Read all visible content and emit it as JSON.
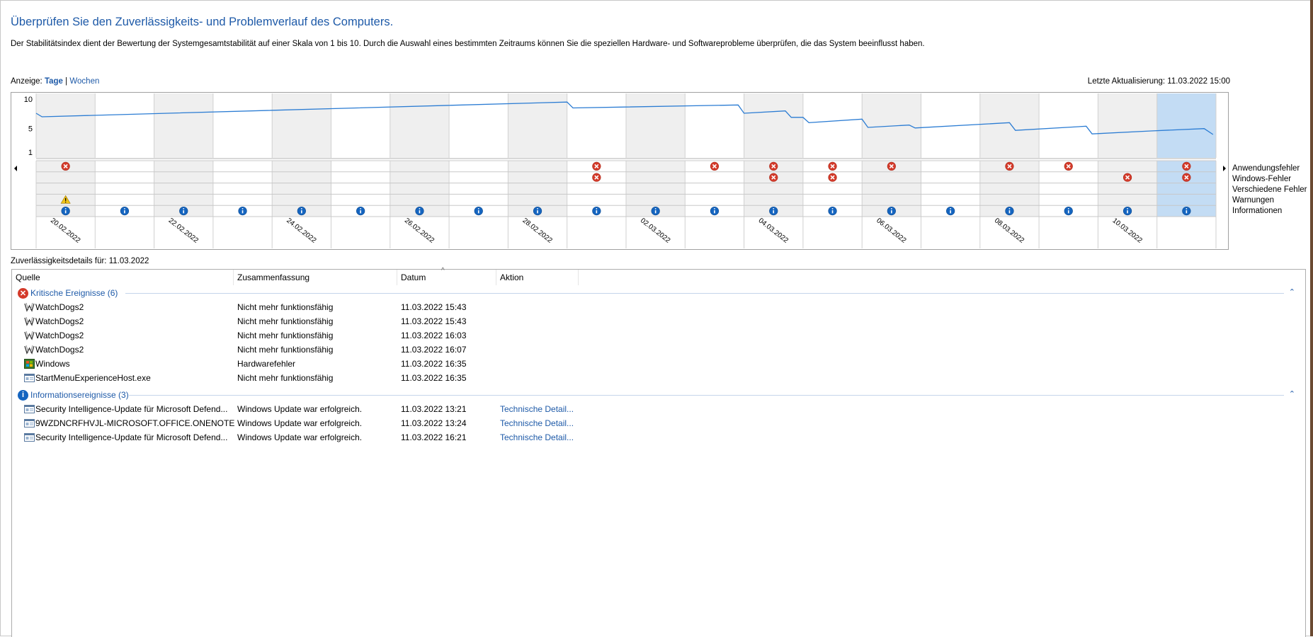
{
  "header": {
    "title": "Überprüfen Sie den Zuverlässigkeits- und Problemverlauf des Computers.",
    "description": "Der Stabilitätsindex dient der Bewertung der Systemgesamtstabilität auf einer Skala von 1 bis 10. Durch die Auswahl eines bestimmten Zeitraums können Sie die speziellen Hardware- und Softwareprobleme überprüfen, die das System beeinflusst haben."
  },
  "view": {
    "label": "Anzeige:",
    "days": "Tage",
    "separator": "|",
    "weeks": "Wochen",
    "last_update": "Letzte Aktualisierung: 11.03.2022 15:00"
  },
  "legend": [
    "Anwendungsfehler",
    "Windows-Fehler",
    "Verschiedene Fehler",
    "Warnungen",
    "Informationen"
  ],
  "colors": {
    "accent": "#1e5aa8",
    "line": "#2b7cd3",
    "error": "#d43a2a",
    "warning": "#f0c419",
    "info": "#1565c0",
    "selected": "#c3dcf4",
    "shade": "#efefef"
  },
  "chart_data": {
    "type": "line",
    "title": "",
    "ylim": [
      1,
      10
    ],
    "y_ticks": [
      "10",
      "5",
      "1"
    ],
    "columns": 20,
    "x_tick_labels": [
      "20.02.2022",
      "22.02.2022",
      "24.02.2022",
      "26.02.2022",
      "28.02.2022",
      "02.03.2022",
      "04.03.2022",
      "06.03.2022",
      "08.03.2022",
      "10.03.2022"
    ],
    "x_tick_columns": [
      0,
      2,
      4,
      6,
      8,
      10,
      12,
      14,
      16,
      18
    ],
    "stability_series": [
      {
        "x": 0.0,
        "y": 7.6
      },
      {
        "x": 0.1,
        "y": 7.0
      },
      {
        "x": 9.0,
        "y": 9.5
      },
      {
        "x": 9.1,
        "y": 8.5
      },
      {
        "x": 11.9,
        "y": 9.0
      },
      {
        "x": 12.0,
        "y": 7.6
      },
      {
        "x": 12.7,
        "y": 8.0
      },
      {
        "x": 12.8,
        "y": 6.9
      },
      {
        "x": 13.0,
        "y": 6.9
      },
      {
        "x": 13.1,
        "y": 6.0
      },
      {
        "x": 14.0,
        "y": 6.6
      },
      {
        "x": 14.1,
        "y": 5.2
      },
      {
        "x": 14.8,
        "y": 5.6
      },
      {
        "x": 14.9,
        "y": 5.1
      },
      {
        "x": 16.5,
        "y": 6.0
      },
      {
        "x": 16.6,
        "y": 4.7
      },
      {
        "x": 17.8,
        "y": 5.4
      },
      {
        "x": 17.9,
        "y": 4.1
      },
      {
        "x": 18.9,
        "y": 4.6
      },
      {
        "x": 19.8,
        "y": 5.0
      },
      {
        "x": 19.95,
        "y": 4.0
      }
    ],
    "selected_column": 19,
    "shaded_columns": [
      0,
      2,
      4,
      6,
      8,
      10,
      12,
      14,
      16,
      18
    ],
    "event_rows": [
      {
        "name": "Anwendungsfehler",
        "kind": "error",
        "columns": [
          0,
          9,
          11,
          12,
          13,
          14,
          16,
          17,
          19
        ]
      },
      {
        "name": "Windows-Fehler",
        "kind": "error",
        "columns": [
          9,
          12,
          13,
          18,
          19
        ]
      },
      {
        "name": "Verschiedene Fehler",
        "kind": "error",
        "columns": []
      },
      {
        "name": "Warnungen",
        "kind": "warning",
        "columns": [
          0
        ]
      },
      {
        "name": "Informationen",
        "kind": "info",
        "columns": [
          0,
          1,
          2,
          3,
          4,
          5,
          6,
          7,
          8,
          9,
          10,
          11,
          12,
          13,
          14,
          15,
          16,
          17,
          18,
          19
        ]
      }
    ]
  },
  "details": {
    "label": "Zuverlässigkeitsdetails für: 11.03.2022"
  },
  "table": {
    "columns": [
      "Quelle",
      "Zusammenfassung",
      "Datum",
      "Aktion"
    ],
    "sort_indicator": "^",
    "groups": [
      {
        "title": "Kritische Ereignisse (6)",
        "kind": "error",
        "rows": [
          {
            "icon": "watchdogs-icon",
            "source": "WatchDogs2",
            "summary": "Nicht mehr funktionsfähig",
            "date": "11.03.2022 15:43",
            "action": ""
          },
          {
            "icon": "watchdogs-icon",
            "source": "WatchDogs2",
            "summary": "Nicht mehr funktionsfähig",
            "date": "11.03.2022 15:43",
            "action": ""
          },
          {
            "icon": "watchdogs-icon",
            "source": "WatchDogs2",
            "summary": "Nicht mehr funktionsfähig",
            "date": "11.03.2022 16:03",
            "action": ""
          },
          {
            "icon": "watchdogs-icon",
            "source": "WatchDogs2",
            "summary": "Nicht mehr funktionsfähig",
            "date": "11.03.2022 16:07",
            "action": ""
          },
          {
            "icon": "windows-icon",
            "source": "Windows",
            "summary": "Hardwarefehler",
            "date": "11.03.2022 16:35",
            "action": ""
          },
          {
            "icon": "app-window-icon",
            "source": "StartMenuExperienceHost.exe",
            "summary": "Nicht mehr funktionsfähig",
            "date": "11.03.2022 16:35",
            "action": ""
          }
        ]
      },
      {
        "title": "Informationsereignisse (3)",
        "kind": "info",
        "rows": [
          {
            "icon": "app-window-icon",
            "source": "Security Intelligence-Update für Microsoft Defend...",
            "summary": "Windows Update war erfolgreich.",
            "date": "11.03.2022 13:21",
            "action": "Technische Detail..."
          },
          {
            "icon": "app-window-icon",
            "source": "9WZDNCRFHVJL-MICROSOFT.OFFICE.ONENOTE",
            "summary": "Windows Update war erfolgreich.",
            "date": "11.03.2022 13:24",
            "action": "Technische Detail..."
          },
          {
            "icon": "app-window-icon",
            "source": "Security Intelligence-Update für Microsoft Defend...",
            "summary": "Windows Update war erfolgreich.",
            "date": "11.03.2022 16:21",
            "action": "Technische Detail..."
          }
        ]
      }
    ]
  }
}
